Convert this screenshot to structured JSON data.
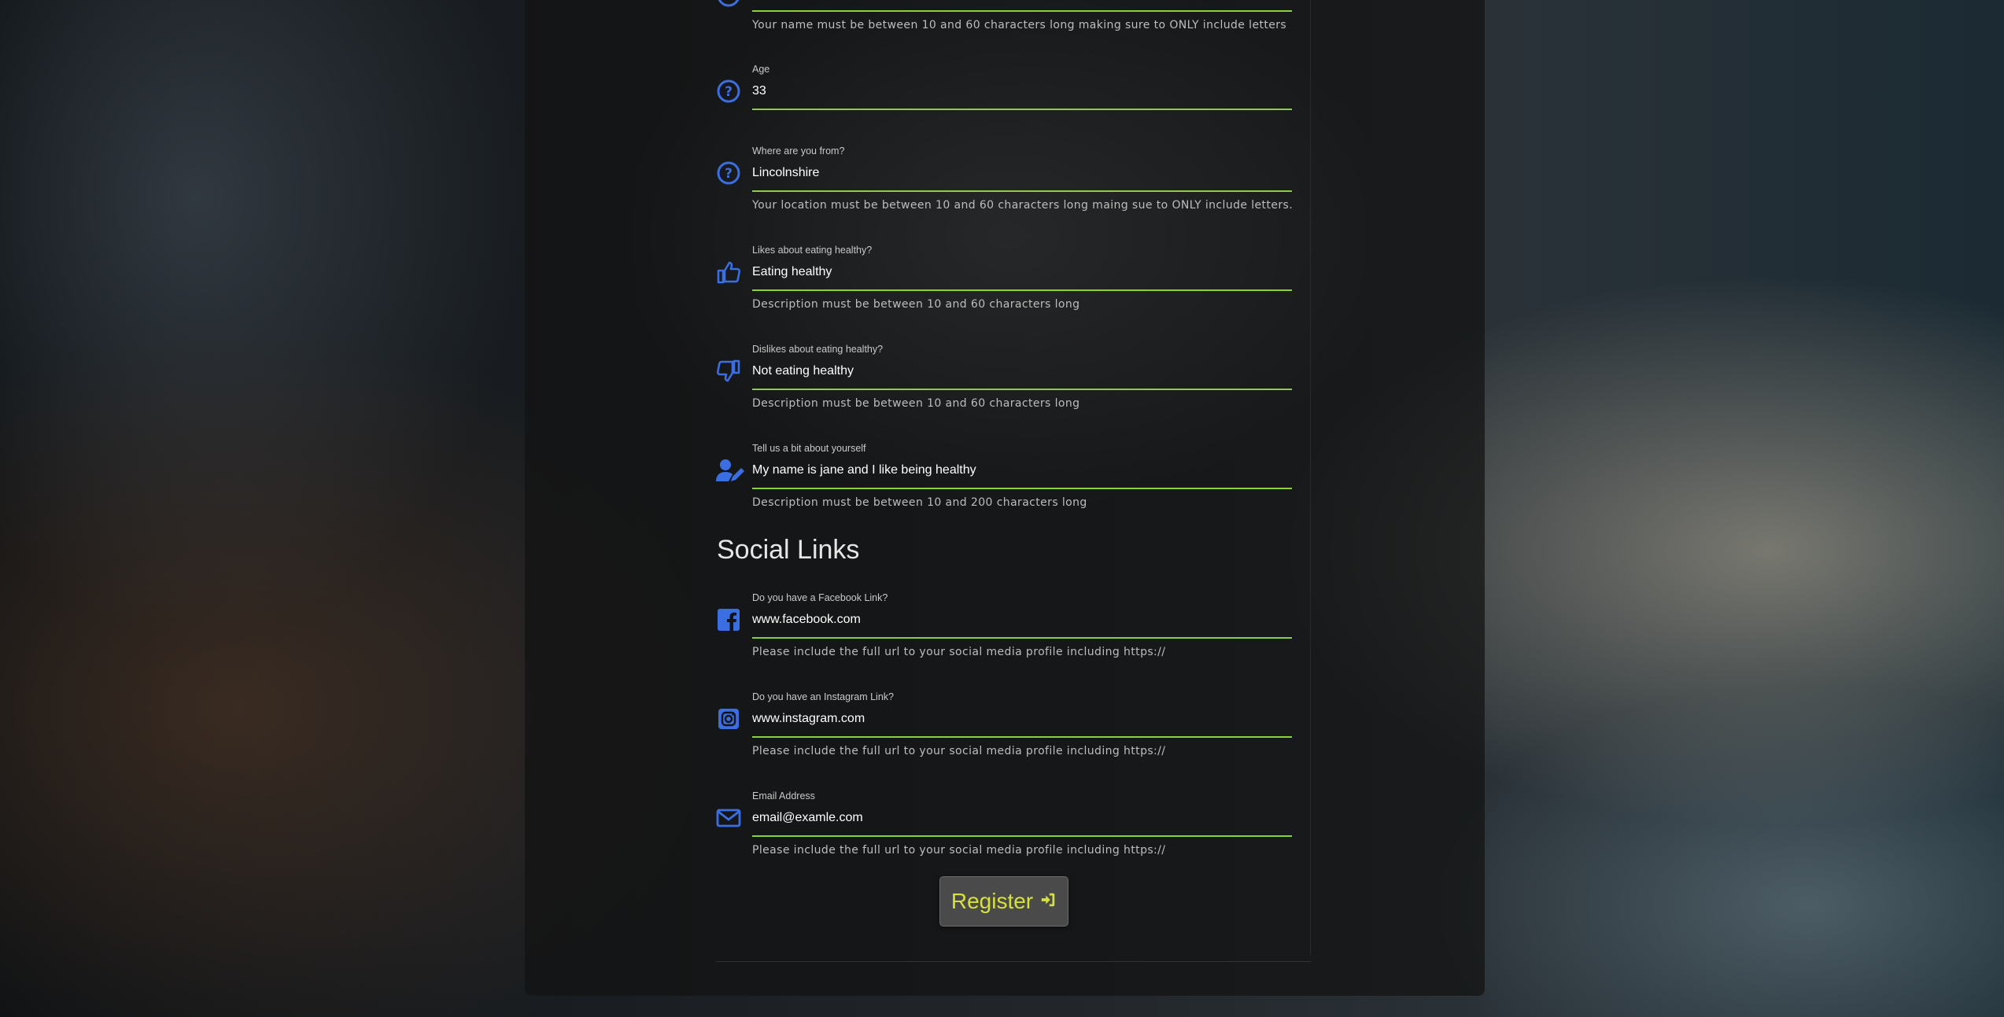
{
  "fields": [
    {
      "id": "name",
      "help": "Your name must be between 10 and 60 characters long making sure to ONLY include letters"
    },
    {
      "id": "age",
      "label": "Age",
      "value": "33",
      "icon": "question-circle-icon"
    },
    {
      "id": "location",
      "label": "Where are you from?",
      "value": "Lincolnshire",
      "icon": "question-circle-icon",
      "help": "Your location must be between 10 and 60 characters long maing sue to ONLY include letters."
    },
    {
      "id": "likes",
      "label": "Likes about eating healthy?",
      "value": "Eating healthy",
      "icon": "thumbs-up-icon",
      "help": "Description must be between 10 and 60 characters long"
    },
    {
      "id": "dislikes",
      "label": "Dislikes about eating healthy?",
      "value": "Not eating healthy",
      "icon": "thumbs-down-icon",
      "help": "Description must be between 10 and 60 characters long"
    },
    {
      "id": "about",
      "label": "Tell us a bit about yourself",
      "value": "My name is jane and I like being healthy",
      "icon": "user-edit-icon",
      "help": "Description must be between 10 and 200 characters long"
    }
  ],
  "social": {
    "title": "Social Links",
    "fields": [
      {
        "id": "facebook",
        "label": "Do you have a Facebook Link?",
        "value": "www.facebook.com",
        "icon": "facebook-icon",
        "help": "Please include the full url to your social media profile including https://"
      },
      {
        "id": "instagram",
        "label": "Do you have an Instagram Link?",
        "value": "www.instagram.com",
        "icon": "instagram-icon",
        "help": "Please include the full url to your social media profile including https://"
      },
      {
        "id": "email",
        "label": "Email Address",
        "value": "email@examle.com",
        "icon": "envelope-icon",
        "help": "Please include the full url to your social media profile including https://"
      }
    ]
  },
  "register_label": "Register",
  "colors": {
    "accent": "#8bd13d",
    "icon": "#3b6ee3",
    "button_text": "#d6e23a"
  }
}
